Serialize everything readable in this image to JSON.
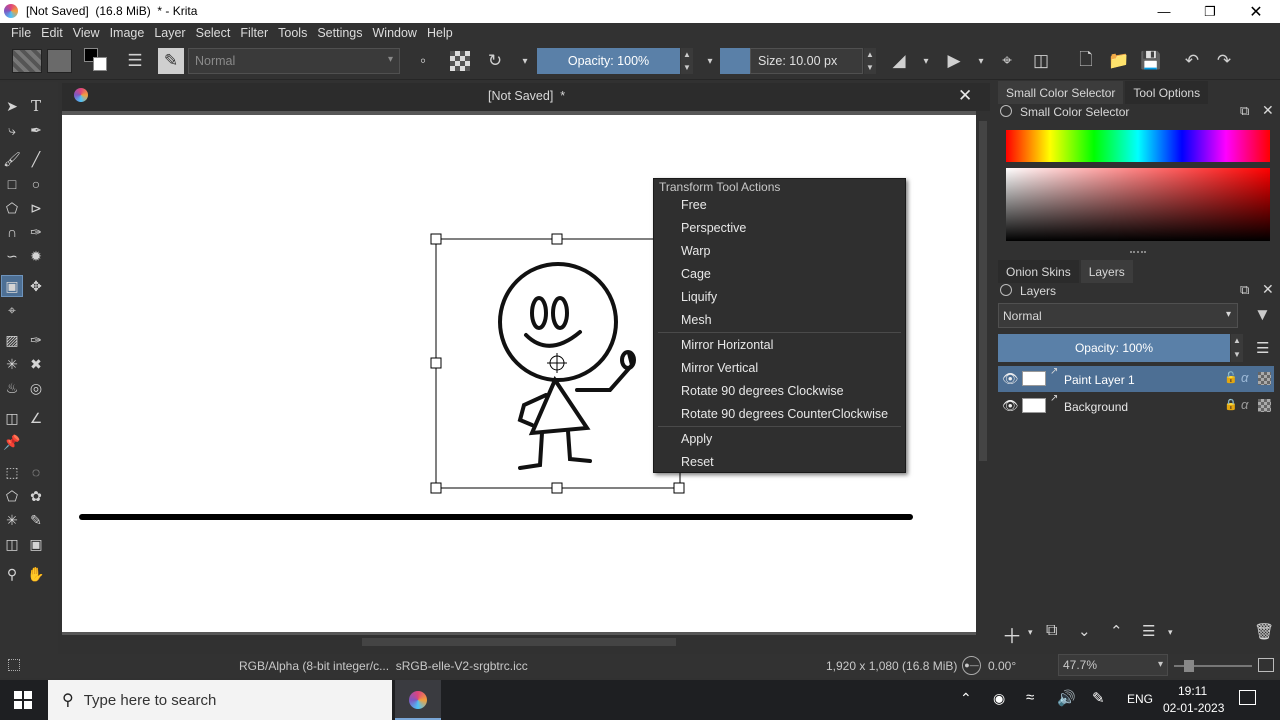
{
  "window": {
    "title": "[Not Saved]  (16.8 MiB)  * - Krita"
  },
  "menubar": {
    "items": [
      {
        "label": "File"
      },
      {
        "label": "Edit"
      },
      {
        "label": "View"
      },
      {
        "label": "Image"
      },
      {
        "label": "Layer"
      },
      {
        "label": "Select"
      },
      {
        "label": "Filter"
      },
      {
        "label": "Tools"
      },
      {
        "label": "Settings"
      },
      {
        "label": "Window"
      },
      {
        "label": "Help"
      }
    ]
  },
  "toolbar": {
    "blend_mode": "Normal",
    "opacity_label": "Opacity: 100%",
    "size_label": "Size: 10.00 px"
  },
  "document": {
    "tab_title": "[Not Saved]  *"
  },
  "context_menu": {
    "header": "Transform Tool Actions",
    "items": [
      "Free",
      "Perspective",
      "Warp",
      "Cage",
      "Liquify",
      "Mesh",
      "Mirror Horizontal",
      "Mirror Vertical",
      "Rotate 90 degrees Clockwise",
      "Rotate 90 degrees CounterClockwise",
      "Apply",
      "Reset"
    ]
  },
  "docker": {
    "top_tabs": [
      "Small Color Selector",
      "Tool Options"
    ],
    "color_selector_title": "Small Color Selector",
    "mid_tabs": [
      "Onion Skins",
      "Layers"
    ],
    "layers_title": "Layers",
    "blend_mode": "Normal",
    "opacity_label": "Opacity:  100%",
    "layers": [
      {
        "name": "Paint Layer 1",
        "selected": true
      },
      {
        "name": "Background",
        "selected": false
      }
    ]
  },
  "statusbar": {
    "color_profile": "RGB/Alpha (8-bit integer/c...  sRGB-elle-V2-srgbtrc.icc",
    "dimensions": "1,920 x 1,080 (16.8 MiB)",
    "rotation": "0.00°",
    "zoom": "47.7%"
  },
  "taskbar": {
    "search_placeholder": "Type here to search",
    "language": "ENG",
    "time": "19:11",
    "date": "02-01-2023"
  },
  "colors": {
    "accent": "#5a80a8",
    "selection": "#4d6f94",
    "panel": "#323232"
  }
}
